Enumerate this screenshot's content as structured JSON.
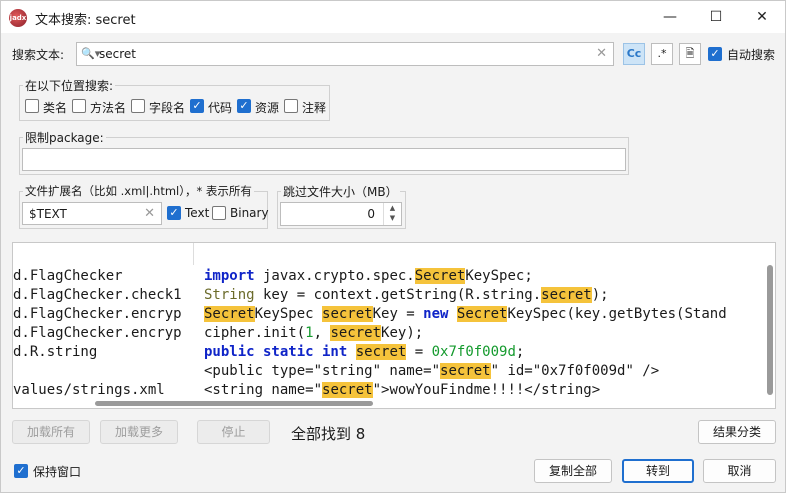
{
  "window": {
    "title": "文本搜索: secret",
    "app_icon": "jadx"
  },
  "search": {
    "label": "搜索文本:",
    "value": "secret",
    "case_btn": "Cc",
    "regex_btn": ".*",
    "auto_search_label": "自动搜索"
  },
  "search_in": {
    "title": "在以下位置搜索:",
    "options": [
      {
        "label": "类名",
        "checked": false
      },
      {
        "label": "方法名",
        "checked": false
      },
      {
        "label": "字段名",
        "checked": false
      },
      {
        "label": "代码",
        "checked": true
      },
      {
        "label": "资源",
        "checked": true
      },
      {
        "label": "注释",
        "checked": false
      }
    ]
  },
  "package": {
    "title": "限制package:",
    "value": ""
  },
  "file_ext": {
    "title": "文件扩展名（比如 .xml|.html），* 表示所有",
    "value": "$TEXT",
    "text_label": "Text",
    "binary_label": "Binary"
  },
  "skip_size": {
    "title": "跳过文件大小（MB）",
    "value": "0"
  },
  "results": [
    {
      "node": "d.FlagChecker",
      "code": [
        [
          "kw",
          "import"
        ],
        [
          "t",
          " javax.crypto.spec."
        ],
        [
          "hl",
          "Secret"
        ],
        [
          "t",
          "KeySpec;"
        ]
      ]
    },
    {
      "node": "d.FlagChecker.check1",
      "code": [
        [
          "ty",
          "String"
        ],
        [
          "t",
          " key = context.getString(R.string."
        ],
        [
          "hl",
          "secret"
        ],
        [
          "t",
          ");"
        ]
      ]
    },
    {
      "node": "d.FlagChecker.encryp",
      "code": [
        [
          "hl",
          "Secret"
        ],
        [
          "t",
          "KeySpec "
        ],
        [
          "hl",
          "secret"
        ],
        [
          "t",
          "Key = "
        ],
        [
          "kw",
          "new"
        ],
        [
          "t",
          " "
        ],
        [
          "hl",
          "Secret"
        ],
        [
          "t",
          "KeySpec(key.getBytes(Stand"
        ]
      ]
    },
    {
      "node": "d.FlagChecker.encryp",
      "code": [
        [
          "t",
          "cipher.init("
        ],
        [
          "num",
          "1"
        ],
        [
          "t",
          ", "
        ],
        [
          "hl",
          "secret"
        ],
        [
          "t",
          "Key);"
        ]
      ]
    },
    {
      "node": "d.R.string",
      "code": [
        [
          "kw",
          "public static int"
        ],
        [
          "t",
          " "
        ],
        [
          "hl",
          "secret"
        ],
        [
          "t",
          " = "
        ],
        [
          "num",
          "0x7f0f009d"
        ],
        [
          "t",
          ";"
        ]
      ]
    },
    {
      "node": "",
      "code": [
        [
          "t",
          "<public type=\"string\" name=\""
        ],
        [
          "hl",
          "secret"
        ],
        [
          "t",
          "\" id=\"0x7f0f009d\" />"
        ]
      ]
    },
    {
      "node": "values/strings.xml",
      "code": [
        [
          "t",
          "<string name=\""
        ],
        [
          "hl",
          "secret"
        ],
        [
          "t",
          "\">wowYouFindme!!!!</string>"
        ]
      ]
    }
  ],
  "buttons": {
    "load_all": "加载所有",
    "load_more": "加载更多",
    "stop": "停止",
    "found_text": "全部找到 8",
    "sort": "结果分类",
    "keep_window": "保持窗口",
    "copy_all": "复制全部",
    "goto": "转到",
    "cancel": "取消"
  }
}
